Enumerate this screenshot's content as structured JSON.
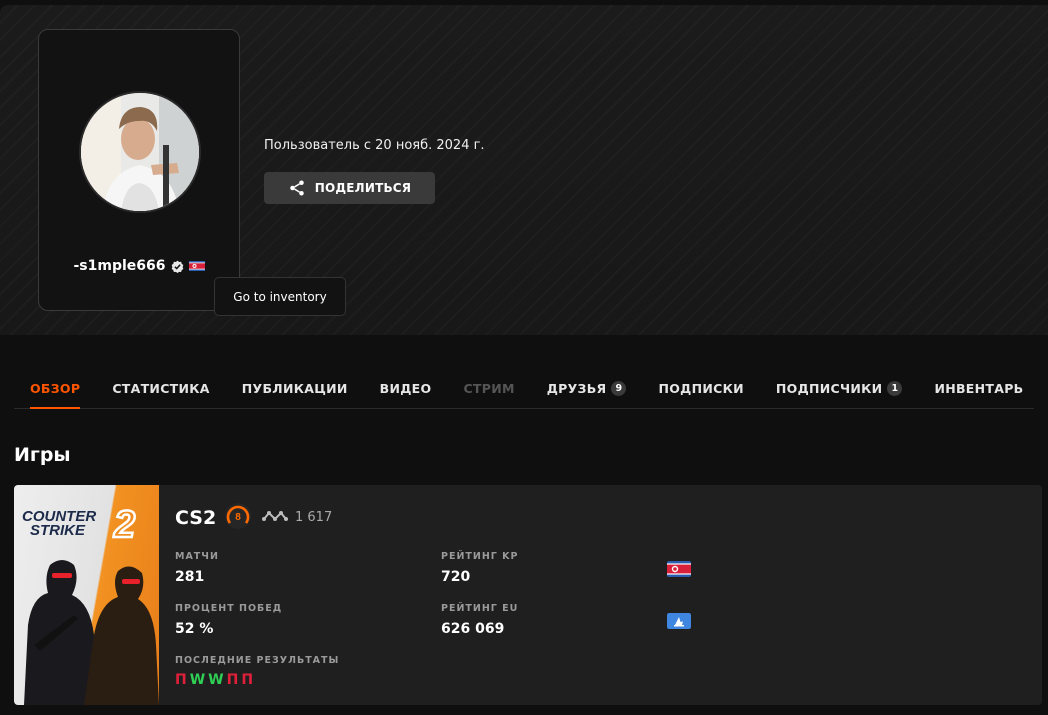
{
  "profile": {
    "username": "-s1mple666",
    "member_since": "Пользователь с 20 нояб. 2024 г.",
    "share_label": "ПОДЕЛИТЬСЯ",
    "tooltip": "Go to inventory"
  },
  "tabs": [
    {
      "label": "ОБЗОР",
      "state": "active"
    },
    {
      "label": "СТАТИСТИКА"
    },
    {
      "label": "ПУБЛИКАЦИИ"
    },
    {
      "label": "ВИДЕО"
    },
    {
      "label": "СТРИМ",
      "state": "disabled"
    },
    {
      "label": "ДРУЗЬЯ",
      "badge": "9"
    },
    {
      "label": "ПОДПИСКИ"
    },
    {
      "label": "ПОДПИСЧИКИ",
      "badge": "1"
    },
    {
      "label": "ИНВЕНТАРЬ"
    }
  ],
  "games_section": {
    "title": "Игры"
  },
  "game": {
    "cover_text_1": "COUNTER",
    "cover_text_2": "STRIKE",
    "cover_number": "2",
    "name": "CS2",
    "level": "8",
    "elo": "1 617",
    "matches_label": "МАТЧИ",
    "matches": "281",
    "winrate_label": "ПРОЦЕНТ ПОБЕД",
    "winrate": "52 %",
    "rating_kp_label": "РЕЙТИНГ KP",
    "rating_kp": "720",
    "rating_eu_label": "РЕЙТИНГ EU",
    "rating_eu": "626 069",
    "recent_label": "ПОСЛЕДНИЕ РЕЗУЛЬТАТЫ",
    "recent": [
      "П",
      "W",
      "W",
      "П",
      "П"
    ]
  },
  "colors": {
    "accent": "#ff5500",
    "win": "#2fcf55",
    "loss": "#e0203a",
    "level": "#ff6a00"
  },
  "icons": [
    "verified-icon",
    "flag-icon",
    "share-icon",
    "level-icon",
    "elo-icon",
    "region-flag-icon"
  ]
}
